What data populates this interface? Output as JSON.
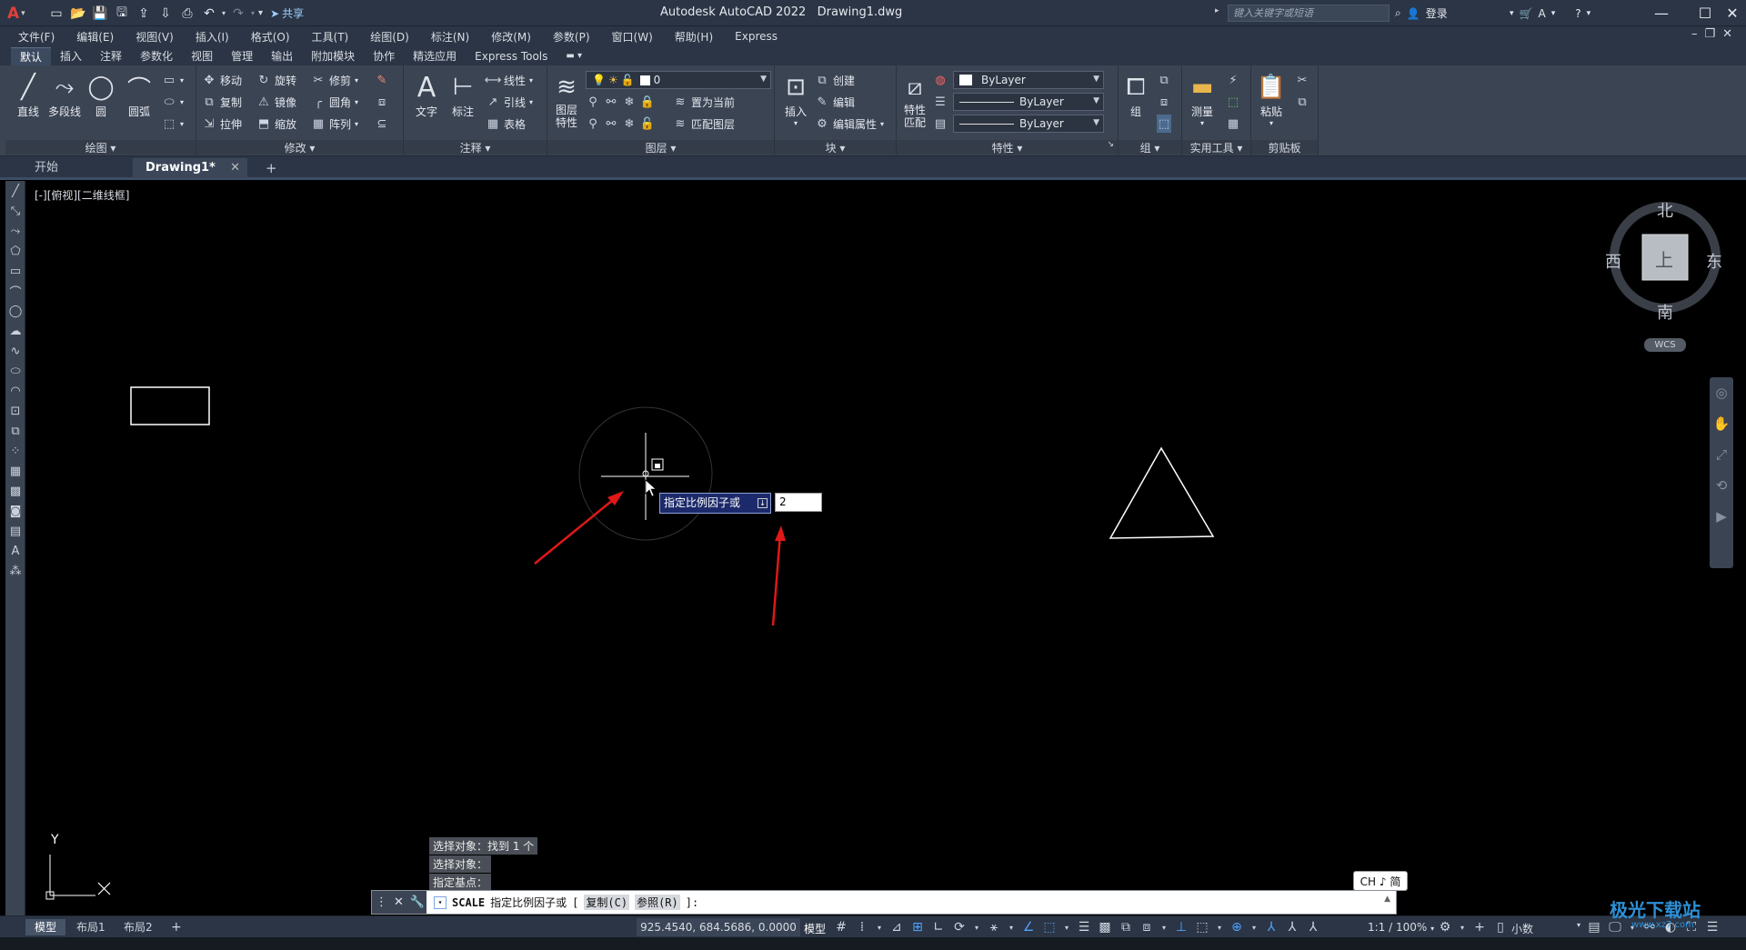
{
  "title": {
    "app": "Autodesk AutoCAD 2022",
    "doc": "Drawing1.dwg"
  },
  "qat": {
    "share": "共享"
  },
  "search": {
    "placeholder": "键入关键字或短语"
  },
  "account": {
    "login": "登录"
  },
  "menu": [
    "文件(F)",
    "编辑(E)",
    "视图(V)",
    "插入(I)",
    "格式(O)",
    "工具(T)",
    "绘图(D)",
    "标注(N)",
    "修改(M)",
    "参数(P)",
    "窗口(W)",
    "帮助(H)",
    "Express"
  ],
  "ribbon_tabs": [
    "默认",
    "插入",
    "注释",
    "参数化",
    "视图",
    "管理",
    "输出",
    "附加模块",
    "协作",
    "精选应用",
    "Express Tools"
  ],
  "ribbon": {
    "draw": {
      "title": "绘图",
      "line": "直线",
      "polyline": "多段线",
      "circle": "圆",
      "arc": "圆弧"
    },
    "modify": {
      "title": "修改",
      "move": "移动",
      "rotate": "旋转",
      "trim": "修剪",
      "copy": "复制",
      "mirror": "镜像",
      "fillet": "圆角",
      "stretch": "拉伸",
      "scale": "缩放",
      "array": "阵列"
    },
    "annotation": {
      "title": "注释",
      "text": "文字",
      "dimension": "标注",
      "linear": "线性",
      "leader": "引线",
      "table": "表格"
    },
    "layers": {
      "title": "图层",
      "layer_props": "图层特性",
      "layer_props_l1": "图层",
      "layer_props_l2": "特性",
      "layer_value": "0",
      "set_current": "置为当前",
      "match_layer": "匹配图层"
    },
    "block": {
      "title": "块",
      "insert": "插入",
      "create": "创建",
      "edit": "编辑",
      "edit_attr": "编辑属性"
    },
    "properties": {
      "title": "特性",
      "match_l1": "特性",
      "match_l2": "匹配",
      "color": "ByLayer",
      "linetype": "ByLayer",
      "lineweight": "ByLayer"
    },
    "groups": {
      "title": "组",
      "group": "组"
    },
    "utilities": {
      "title": "实用工具",
      "measure": "测量"
    },
    "clipboard": {
      "title": "剪贴板",
      "paste": "粘贴"
    }
  },
  "file_tabs": {
    "start": "开始",
    "drawing": "Drawing1*"
  },
  "viewport": {
    "label": "[-][俯视][二维线框]"
  },
  "viewcube": {
    "north": "北",
    "south": "南",
    "west": "西",
    "east": "东",
    "face": "上",
    "wcs": "WCS"
  },
  "ucs": {
    "y": "Y",
    "x": "X"
  },
  "dynamic_input": {
    "prompt": "指定比例因子或",
    "value": "2"
  },
  "command_history": [
    "选择对象：找到 1 个",
    "选择对象：",
    "指定基点："
  ],
  "command_line": {
    "name": "SCALE",
    "prompt": "指定比例因子或",
    "open_bracket": "[",
    "opt1": "复制(C)",
    "opt2": "参照(R)",
    "close": "]:"
  },
  "ime": {
    "text": "CH ♪ 简"
  },
  "status": {
    "tabs": [
      "模型",
      "布局1",
      "布局2"
    ],
    "coords": "925.4540, 684.5686, 0.0000",
    "model": "模型",
    "scale": "1:1 / 100%",
    "units": "小数"
  },
  "watermark": {
    "text": "极光下载站",
    "url": "www.xz7.com"
  }
}
